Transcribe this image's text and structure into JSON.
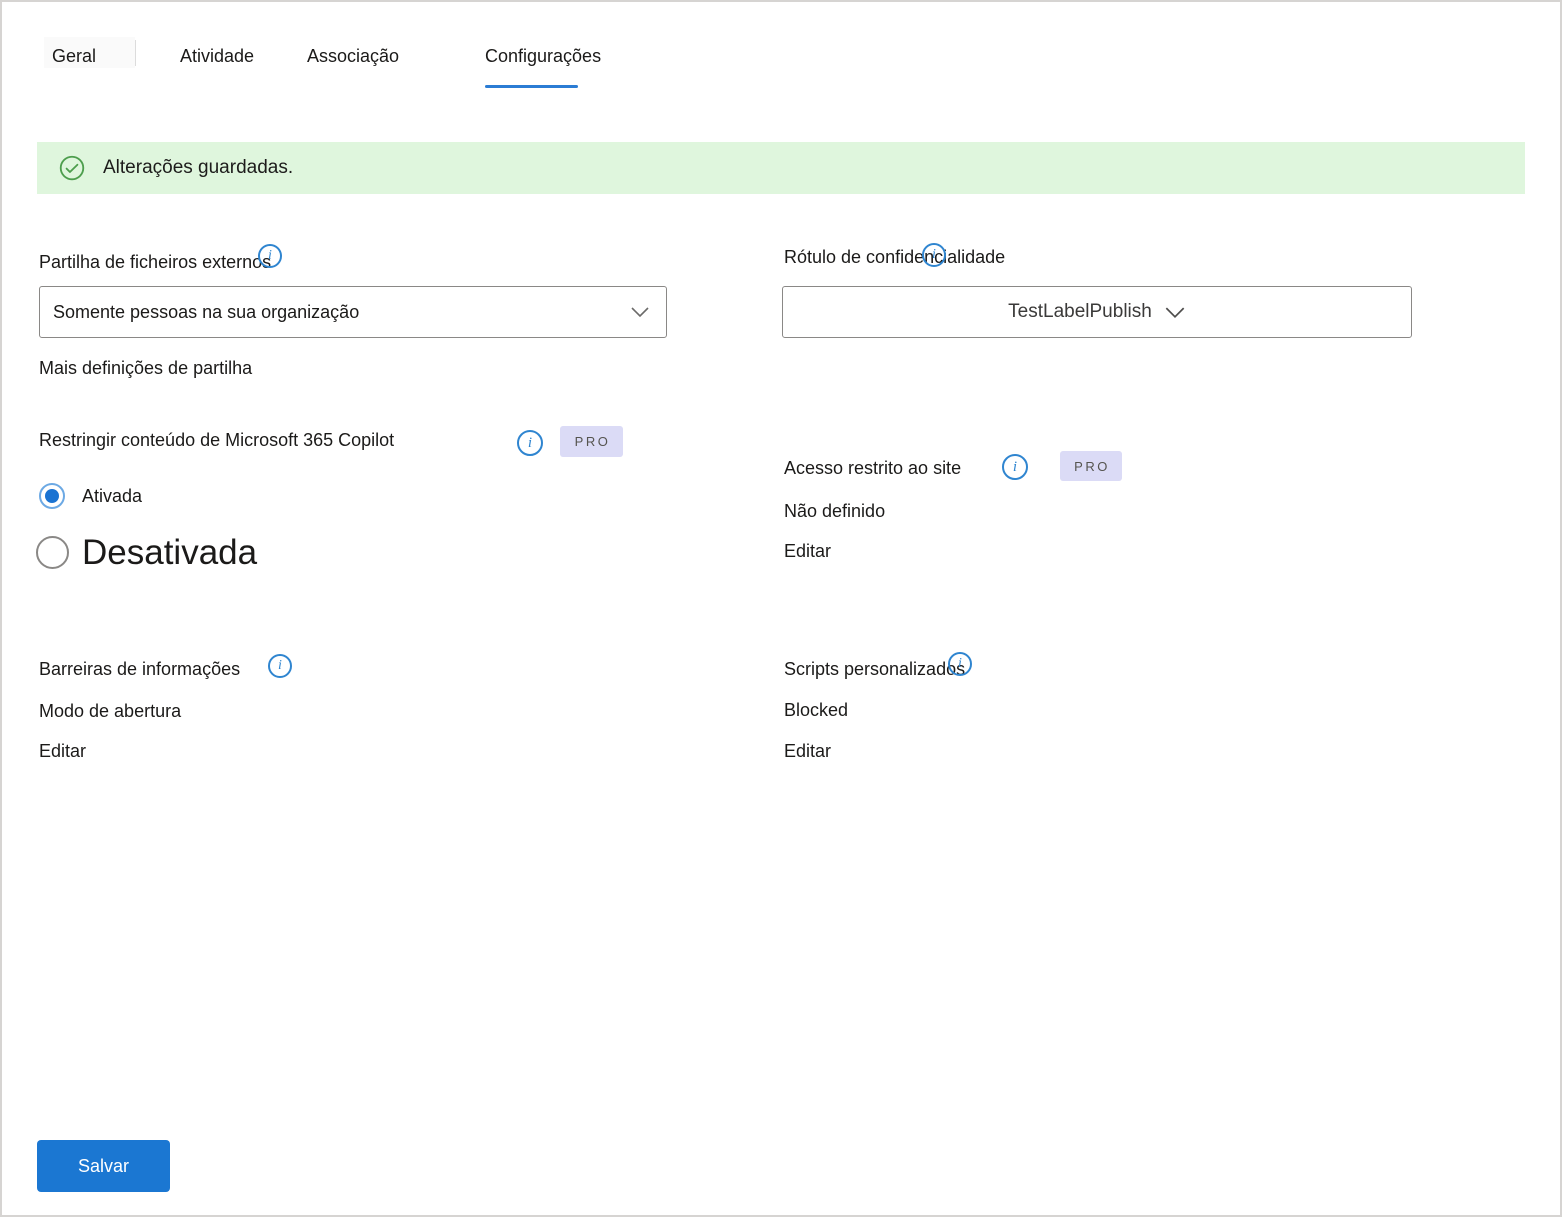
{
  "tabs": {
    "items": [
      {
        "label": "Geral",
        "active": false
      },
      {
        "label": "Atividade",
        "active": false
      },
      {
        "label": "Associação",
        "active": false
      },
      {
        "label": "Configurações",
        "active": true
      }
    ]
  },
  "banner": {
    "message": "Alterações guardadas.",
    "icon": "check-circle-icon"
  },
  "external_sharing": {
    "label": "Partilha de ficheiros externos",
    "selected_option": "Somente pessoas na sua organização",
    "more_link": "Mais definições de partilha"
  },
  "sensitivity_label": {
    "label": "Rótulo de confidencialidade",
    "selected_option": "TestLabelPublish"
  },
  "copilot_restrict": {
    "label": "Restringir conteúdo de Microsoft 365 Copilot",
    "badge": "PRO",
    "options": [
      {
        "label": "Ativada",
        "selected": true
      },
      {
        "label": "Desativada",
        "selected": false
      }
    ]
  },
  "restricted_site_access": {
    "label": "Acesso restrito ao site",
    "badge": "PRO",
    "status": "Não definido",
    "action": "Editar"
  },
  "information_barriers": {
    "label": "Barreiras de informações",
    "mode": "Modo de abertura",
    "action": "Editar"
  },
  "custom_scripts": {
    "label": "Scripts personalizados",
    "status": "Blocked",
    "action": "Editar"
  },
  "footer": {
    "save_label": "Salvar"
  },
  "icons": {
    "info_glyph": "i"
  },
  "colors": {
    "accent_blue": "#2b7cd4",
    "button_blue": "#1b77d2",
    "info_icon_blue": "#2f85d0",
    "pro_badge_bg": "#dbdbf6",
    "banner_green_bg": "#dff6dd",
    "success_icon_green": "#4d9e4d",
    "radio_selected_blue": "#1a73d2",
    "text": "#1b1a19"
  }
}
